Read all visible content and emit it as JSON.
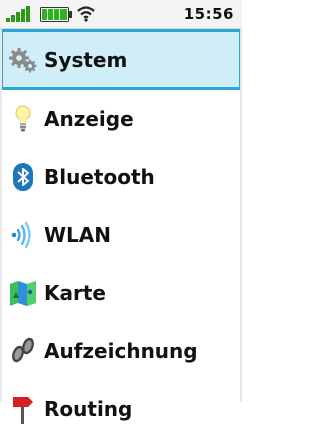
{
  "status": {
    "time": "15:56",
    "signal_icon": "signal-bars-icon",
    "battery_icon": "battery-icon",
    "wifi_icon": "wifi-icon"
  },
  "menu": {
    "items": [
      {
        "label": "System",
        "icon": "gears-icon",
        "selected": true
      },
      {
        "label": "Anzeige",
        "icon": "lightbulb-icon"
      },
      {
        "label": "Bluetooth",
        "icon": "bluetooth-icon"
      },
      {
        "label": "WLAN",
        "icon": "wlan-icon"
      },
      {
        "label": "Karte",
        "icon": "map-icon"
      },
      {
        "label": "Aufzeichnung",
        "icon": "footprints-icon"
      },
      {
        "label": "Routing",
        "icon": "routing-icon"
      }
    ]
  },
  "colors": {
    "accent": "#2aa6d8",
    "selected_bg": "#cfeef8",
    "battery_green": "#29b51d"
  }
}
